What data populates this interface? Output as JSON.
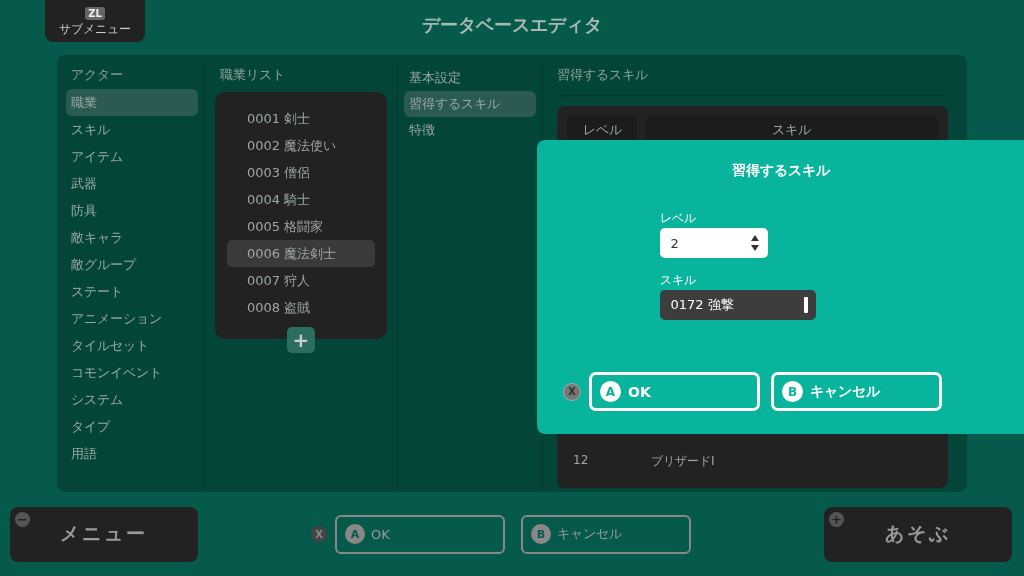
{
  "header": {
    "submenu": {
      "key": "ZL",
      "label": "サブメニュー"
    },
    "title": "データベースエディタ"
  },
  "categories": {
    "heading": "アクター",
    "items": [
      {
        "label": "職業",
        "selected": true
      },
      {
        "label": "スキル",
        "selected": false
      },
      {
        "label": "アイテム",
        "selected": false
      },
      {
        "label": "武器",
        "selected": false
      },
      {
        "label": "防具",
        "selected": false
      },
      {
        "label": "敵キャラ",
        "selected": false
      },
      {
        "label": "敵グループ",
        "selected": false
      },
      {
        "label": "ステート",
        "selected": false
      },
      {
        "label": "アニメーション",
        "selected": false
      },
      {
        "label": "タイルセット",
        "selected": false
      },
      {
        "label": "コモンイベント",
        "selected": false
      },
      {
        "label": "システム",
        "selected": false
      },
      {
        "label": "タイプ",
        "selected": false
      },
      {
        "label": "用語",
        "selected": false
      }
    ]
  },
  "job_list": {
    "heading": "職業リスト",
    "items": [
      {
        "label": "0001 剣士",
        "selected": false
      },
      {
        "label": "0002 魔法使い",
        "selected": false
      },
      {
        "label": "0003 僧侶",
        "selected": false
      },
      {
        "label": "0004 騎士",
        "selected": false
      },
      {
        "label": "0005 格闘家",
        "selected": false
      },
      {
        "label": "0006 魔法剣士",
        "selected": true
      },
      {
        "label": "0007 狩人",
        "selected": false
      },
      {
        "label": "0008 盗賊",
        "selected": false
      }
    ],
    "add_button": "+"
  },
  "settings": {
    "items": [
      {
        "label": "基本設定",
        "selected": false
      },
      {
        "label": "習得するスキル",
        "selected": true
      },
      {
        "label": "特徴",
        "selected": false
      }
    ]
  },
  "skills": {
    "heading": "習得するスキル",
    "columns": [
      "レベル",
      "スキル"
    ],
    "rows": [
      {
        "level": "12",
        "skill": "ブリザードⅠ"
      }
    ]
  },
  "dialog": {
    "title": "習得するスキル",
    "level_label": "レベル",
    "level_value": "2",
    "skill_label": "スキル",
    "skill_value": "0172 強撃",
    "x_key": "X",
    "ok": {
      "key": "A",
      "label": "OK"
    },
    "cancel": {
      "key": "B",
      "label": "キャンセル"
    }
  },
  "footer": {
    "menu": {
      "key": "−",
      "label": "メニュー"
    },
    "x_key": "X",
    "ok": {
      "key": "A",
      "label": "OK"
    },
    "cancel": {
      "key": "B",
      "label": "キャンセル"
    },
    "play": {
      "key": "+",
      "label": "あそぶ"
    }
  }
}
